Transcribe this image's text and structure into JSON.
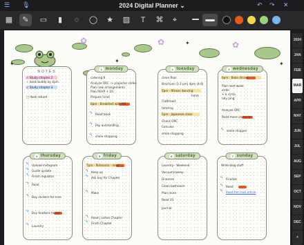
{
  "app": {
    "title": "2024 Digital Planner",
    "chevron": "⌄"
  },
  "toolbar": {
    "tools": [
      "grid-icon",
      "pen-icon",
      "eraser-icon",
      "highlighter-icon",
      "lasso-icon",
      "shape-icon",
      "sticker-icon",
      "image-icon",
      "text-icon",
      "pointer-icon"
    ],
    "colors": [
      "#111111",
      "#e85a1a",
      "#f2d74e",
      "#9ad17a",
      "#7ab7e8"
    ]
  },
  "sidebar": {
    "months": [
      "2024",
      "JAN",
      "FEB",
      "MAR",
      "APR",
      "MAY",
      "JUN",
      "JUL",
      "AUG",
      "SEP",
      "OCT",
      "NOV",
      "DEC",
      "+"
    ],
    "active": "MAR"
  },
  "notes": {
    "title": "NOTES",
    "items": [
      "✓ Study chapter 2",
      "  ✓ book buddy by 4pm",
      "✓ Study chapter 3",
      "□ desk refund"
    ]
  },
  "days": {
    "monday": {
      "label": "monday",
      "num": "1",
      "tasks": [
        "catering 6",
        "Analyze ORC -> projector slides",
        "  Plan new arrangements",
        "  Plan RSVP + 10",
        "Prepare hindi",
        "6pm - Breakfast with MS",
        "Read book",
        "Pay outstanding",
        "smile shopping"
      ]
    },
    "tuesday": {
      "label": "tuesday",
      "num": "2",
      "tasks": [
        "clean floor",
        "Brochure (1-3 pm) 4pm (4-6)",
        "5pm - fitness dancing",
        "hmm",
        "Flatbread",
        "tutoring",
        "5pm - Japanese class",
        "Check ORC",
        "Calculus",
        "smile shopping"
      ]
    },
    "wednesday": {
      "label": "wednesday",
      "num": "3",
      "tasks": [
        "6pm - Bake dinner",
        "Plan next week",
        "  order",
        "  + a circle",
        "  tidy ping",
        "Analyze ORC",
        "Read more on social",
        "smile shopper"
      ]
    },
    "thursday": {
      "label": "thursday",
      "num": "4",
      "tasks": [
        "Upload instagram",
        "Guide update",
        "Finish regulator",
        "Read",
        "Buy stickers for nine",
        "Buy feathers to sell",
        "Laundry"
      ]
    },
    "friday": {
      "label": "friday",
      "num": "5",
      "tasks": [
        "7pm - Rehearse - meal",
        "Keep up",
        "Ask boy for Chapter",
        "Make",
        "Read | Listen Chapter",
        "Finish Chapter"
      ]
    },
    "saturday": {
      "label": "saturday",
      "num": "6",
      "tasks": [
        "Laundry - Weekend",
        "Vacuum/sweep",
        "Finances",
        "Clean bathroom",
        "Plan more",
        "Read 15",
        "Journal"
      ]
    },
    "sunday": {
      "label": "sunday",
      "num": "7",
      "tasks": [
        "Write blog stuff",
        "Finalize",
        "Read",
        "Read the mail article"
      ]
    }
  }
}
